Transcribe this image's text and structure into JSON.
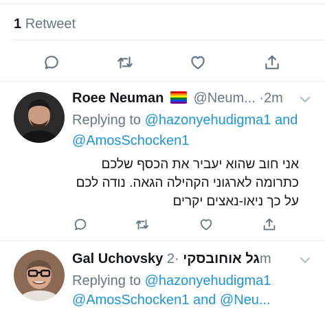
{
  "retweets": {
    "count": "1",
    "label": "Retweet"
  },
  "reply1": {
    "name": "Roee Neuman",
    "handle": "@Neum...",
    "separator": "·",
    "time": "2m",
    "replying_prefix": "Replying to",
    "mention_1": "@hazonyehudigma1",
    "joiner": "and",
    "mention_2": "@AmosSchocken1",
    "text_lines": [
      "אני חוב שהוא יעביר את הכסף שלכם",
      "כתרומה לארגוני הקהילה הגאה. נודה לכם",
      "על כך ניאו-נאצים יקרים"
    ]
  },
  "reply2": {
    "name": "Gal Uchovsky גל אוחובסקי",
    "separator": "·",
    "time": "2m",
    "replying_prefix": "Replying to",
    "mention_1": "@hazonyehudigma1",
    "mention_2": "@AmosSchocken1",
    "joiner": "and",
    "mention_3": "@Neu..."
  },
  "colors": {
    "accent": "#1b95e0",
    "secondary_text": "#657786",
    "divider": "#e6ecf0"
  },
  "icons": [
    "reply-icon",
    "retweet-icon",
    "like-icon",
    "share-icon",
    "chevron-down-icon",
    "rainbow-flag-icon"
  ]
}
